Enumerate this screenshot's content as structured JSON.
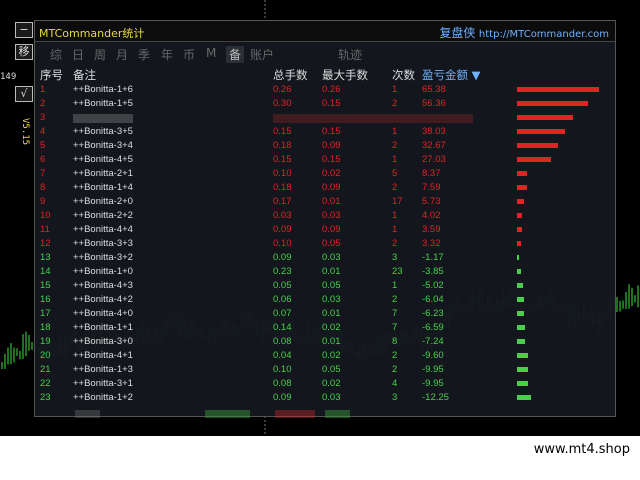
{
  "toolbar": {
    "minimize_label": "−",
    "move_label": "移",
    "number": "149",
    "check_label": "√",
    "version": "V5.15"
  },
  "panel": {
    "title": "MTCommander统计",
    "brand_cn": "复盘侠",
    "brand_url": "http://MTCommander.com",
    "tabs": [
      "综",
      "日",
      "周",
      "月",
      "季",
      "年",
      "币",
      "M",
      "备",
      "账户",
      "轨迹"
    ],
    "active_tab": "备",
    "headers": {
      "index": "序号",
      "remark": "备注",
      "total_lots": "总手数",
      "max_lots": "最大手数",
      "count": "次数",
      "pnl": "盈亏金额 ▼"
    },
    "rows": [
      {
        "i": "1",
        "name": "++Bonitta-1+6",
        "total": "0.26",
        "max": "0.26",
        "count": "1",
        "pnl": "65.38",
        "v": 65.38
      },
      {
        "i": "2",
        "name": "++Bonitta-1+5",
        "total": "0.30",
        "max": "0.15",
        "count": "2",
        "pnl": "56.36",
        "v": 56.36
      },
      {
        "i": "3",
        "name": "",
        "total": "",
        "max": "",
        "count": "",
        "pnl": "",
        "v": 45
      },
      {
        "i": "4",
        "name": "++Bonitta-3+5",
        "total": "0.15",
        "max": "0.15",
        "count": "1",
        "pnl": "38.03",
        "v": 38.03
      },
      {
        "i": "5",
        "name": "++Bonitta-3+4",
        "total": "0.18",
        "max": "0.09",
        "count": "2",
        "pnl": "32.67",
        "v": 32.67
      },
      {
        "i": "6",
        "name": "++Bonitta-4+5",
        "total": "0.15",
        "max": "0.15",
        "count": "1",
        "pnl": "27.03",
        "v": 27.03
      },
      {
        "i": "7",
        "name": "++Bonitta-2+1",
        "total": "0.10",
        "max": "0.02",
        "count": "5",
        "pnl": "8.37",
        "v": 8.37
      },
      {
        "i": "8",
        "name": "++Bonitta-1+4",
        "total": "0.18",
        "max": "0.09",
        "count": "2",
        "pnl": "7.59",
        "v": 7.59
      },
      {
        "i": "9",
        "name": "++Bonitta-2+0",
        "total": "0.17",
        "max": "0.01",
        "count": "17",
        "pnl": "5.73",
        "v": 5.73
      },
      {
        "i": "10",
        "name": "++Bonitta-2+2",
        "total": "0.03",
        "max": "0.03",
        "count": "1",
        "pnl": "4.02",
        "v": 4.02
      },
      {
        "i": "11",
        "name": "++Bonitta-4+4",
        "total": "0.09",
        "max": "0.09",
        "count": "1",
        "pnl": "3.59",
        "v": 3.59
      },
      {
        "i": "12",
        "name": "++Bonitta-3+3",
        "total": "0.10",
        "max": "0.05",
        "count": "2",
        "pnl": "3.32",
        "v": 3.32
      },
      {
        "i": "13",
        "name": "++Bonitta-3+2",
        "total": "0.09",
        "max": "0.03",
        "count": "3",
        "pnl": "-1.17",
        "v": -1.17
      },
      {
        "i": "14",
        "name": "++Bonitta-1+0",
        "total": "0.23",
        "max": "0.01",
        "count": "23",
        "pnl": "-3.85",
        "v": -3.85
      },
      {
        "i": "15",
        "name": "++Bonitta-4+3",
        "total": "0.05",
        "max": "0.05",
        "count": "1",
        "pnl": "-5.02",
        "v": -5.02
      },
      {
        "i": "16",
        "name": "++Bonitta-4+2",
        "total": "0.06",
        "max": "0.03",
        "count": "2",
        "pnl": "-6.04",
        "v": -6.04
      },
      {
        "i": "17",
        "name": "++Bonitta-4+0",
        "total": "0.07",
        "max": "0.01",
        "count": "7",
        "pnl": "-6.23",
        "v": -6.23
      },
      {
        "i": "18",
        "name": "++Bonitta-1+1",
        "total": "0.14",
        "max": "0.02",
        "count": "7",
        "pnl": "-6.59",
        "v": -6.59
      },
      {
        "i": "19",
        "name": "++Bonitta-3+0",
        "total": "0.08",
        "max": "0.01",
        "count": "8",
        "pnl": "-7.24",
        "v": -7.24
      },
      {
        "i": "20",
        "name": "++Bonitta-4+1",
        "total": "0.04",
        "max": "0.02",
        "count": "2",
        "pnl": "-9.60",
        "v": -9.6
      },
      {
        "i": "21",
        "name": "++Bonitta-1+3",
        "total": "0.10",
        "max": "0.05",
        "count": "2",
        "pnl": "-9.95",
        "v": -9.95
      },
      {
        "i": "22",
        "name": "++Bonitta-3+1",
        "total": "0.08",
        "max": "0.02",
        "count": "4",
        "pnl": "-9.95",
        "v": -9.95
      },
      {
        "i": "23",
        "name": "++Bonitta-1+2",
        "total": "0.09",
        "max": "0.03",
        "count": "3",
        "pnl": "-12.25",
        "v": -12.25
      }
    ]
  },
  "footer": {
    "site": "www.mt4.shop"
  },
  "colors": {
    "profit": "#e02424",
    "loss": "#47d14b",
    "title": "#e8d84a",
    "brand": "#6fb0ff"
  }
}
